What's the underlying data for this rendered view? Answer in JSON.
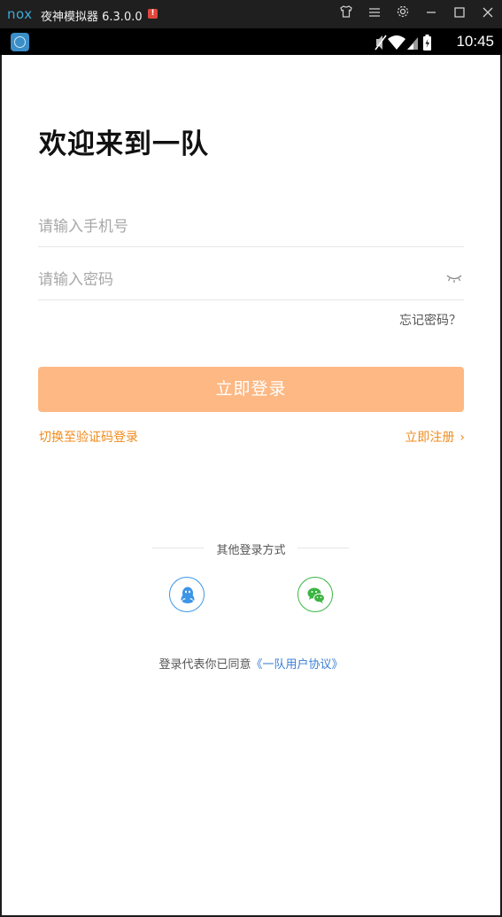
{
  "emulator": {
    "logo": "nox",
    "title": "夜神模拟器 6.3.0.0",
    "alert": "!",
    "controls": [
      "shirt-icon",
      "menu-icon",
      "gear-icon",
      "minimize-icon",
      "maximize-icon",
      "close-icon"
    ]
  },
  "status_bar": {
    "time": "10:45",
    "icons": [
      "mute-icon",
      "wifi-icon",
      "signal-icon",
      "battery-icon"
    ]
  },
  "login": {
    "welcome": "欢迎来到一队",
    "phone_placeholder": "请输入手机号",
    "password_placeholder": "请输入密码",
    "forgot": "忘记密码？",
    "submit": "立即登录",
    "switch_mode": "切换至验证码登录",
    "register": "立即注册",
    "other_methods": "其他登录方式",
    "agreement_prefix": "登录代表你已同意",
    "agreement_link": "《一队用户协议》"
  },
  "colors": {
    "accent": "#f08b1c",
    "button_disabled": "#fdb883",
    "link_blue": "#3a7fd5",
    "qq": "#3c95e6",
    "wechat": "#3bb543"
  }
}
